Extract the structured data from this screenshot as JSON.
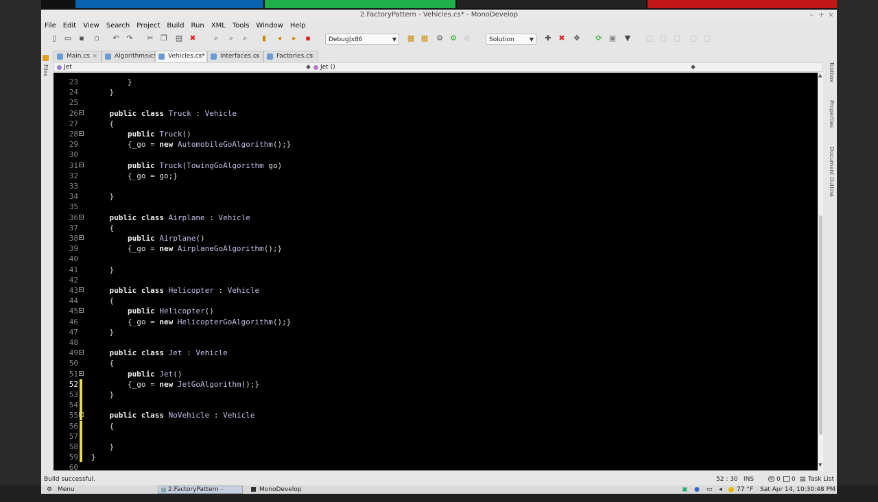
{
  "window": {
    "title": "2.FactoryPattern - Vehicles.cs* - MonoDevelop"
  },
  "menu": [
    "File",
    "Edit",
    "View",
    "Search",
    "Project",
    "Build",
    "Run",
    "XML",
    "Tools",
    "Window",
    "Help"
  ],
  "toolbar": {
    "config": "Debug|x86",
    "scope": "Solution"
  },
  "tabs": [
    {
      "label": "Main.cs",
      "active": false
    },
    {
      "label": "Algorithms.cs",
      "active": false
    },
    {
      "label": "Vehicles.cs*",
      "active": true
    },
    {
      "label": "Interfaces.cs",
      "active": false
    },
    {
      "label": "Factories.cs",
      "active": false
    }
  ],
  "breadcrumb": {
    "left": "Jet",
    "middle": "Jet ()"
  },
  "side_labels": {
    "left": "Files",
    "right": [
      "Toolbox",
      "Properties",
      "Document Outline"
    ]
  },
  "editor": {
    "current_line": 52,
    "lines": [
      {
        "n": "23",
        "code": "        }"
      },
      {
        "n": "24",
        "code": "    }"
      },
      {
        "n": "25",
        "code": ""
      },
      {
        "n": "26",
        "code": "    public class Truck : Vehicle"
      },
      {
        "n": "27",
        "code": "    {"
      },
      {
        "n": "28",
        "code": "        public Truck()"
      },
      {
        "n": "29",
        "code": "        {_go = new AutomobileGoAlgorithm();}"
      },
      {
        "n": "30",
        "code": ""
      },
      {
        "n": "31",
        "code": "        public Truck(TowingGoAlgorithm go)"
      },
      {
        "n": "32",
        "code": "        {_go = go;}"
      },
      {
        "n": "33",
        "code": ""
      },
      {
        "n": "34",
        "code": "    }"
      },
      {
        "n": "35",
        "code": ""
      },
      {
        "n": "36",
        "code": "    public class Airplane : Vehicle"
      },
      {
        "n": "37",
        "code": "    {"
      },
      {
        "n": "38",
        "code": "        public Airplane()"
      },
      {
        "n": "39",
        "code": "        {_go = new AirplaneGoAlgorithm();}"
      },
      {
        "n": "40",
        "code": ""
      },
      {
        "n": "41",
        "code": "    }"
      },
      {
        "n": "42",
        "code": ""
      },
      {
        "n": "43",
        "code": "    public class Helicopter : Vehicle"
      },
      {
        "n": "44",
        "code": "    {"
      },
      {
        "n": "45",
        "code": "        public Helicopter()"
      },
      {
        "n": "46",
        "code": "        {_go = new HelicopterGoAlgorithm();}"
      },
      {
        "n": "47",
        "code": "    }"
      },
      {
        "n": "48",
        "code": ""
      },
      {
        "n": "49",
        "code": "    public class Jet : Vehicle"
      },
      {
        "n": "50",
        "code": "    {"
      },
      {
        "n": "51",
        "code": "        public Jet()"
      },
      {
        "n": "52",
        "code": "        {_go = new JetGoAlgorithm();}"
      },
      {
        "n": "53",
        "code": "    }"
      },
      {
        "n": "54",
        "code": ""
      },
      {
        "n": "55",
        "code": "    public class NoVehicle : Vehicle"
      },
      {
        "n": "56",
        "code": "    {"
      },
      {
        "n": "57",
        "code": ""
      },
      {
        "n": "58",
        "code": "    }"
      },
      {
        "n": "59",
        "code": "}"
      },
      {
        "n": "60",
        "code": ""
      }
    ]
  },
  "status": {
    "message": "Build successful.",
    "position": "52 : 30",
    "mode": "INS",
    "errors": "0",
    "warnings": "0",
    "task_list": "Task List"
  },
  "taskbar": {
    "menu": "Menu",
    "items": [
      "2.FactoryPattern - Veh...",
      "MonoDevelop External..."
    ],
    "weather": "77 °F",
    "clock": "Sat Apr 14, 10:30:48 PM"
  }
}
